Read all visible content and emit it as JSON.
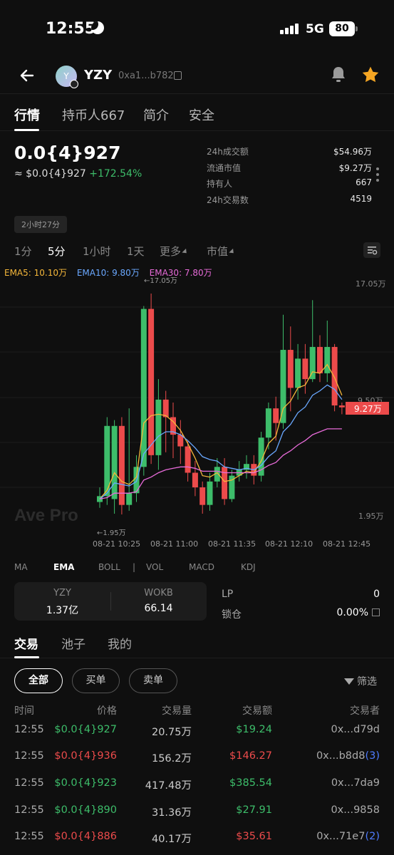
{
  "status_bar": {
    "time": "12:55",
    "network": "5G",
    "battery": "80"
  },
  "header": {
    "token_symbol": "YZY",
    "avatar_letter": "Y",
    "address": "0xa1...b782"
  },
  "tabs": [
    "行情",
    "持币人667",
    "简介",
    "安全"
  ],
  "price": {
    "main": "0.0{4}927",
    "usd_prefix": "≈ $0.0{4}927",
    "change": "+172.54%",
    "age": "2小时27分"
  },
  "stats": [
    {
      "label": "24h成交额",
      "value": "$54.96万"
    },
    {
      "label": "流通市值",
      "value": "$9.27万"
    },
    {
      "label": "持有人",
      "value": "667"
    },
    {
      "label": "24h交易数",
      "value": "4519"
    }
  ],
  "intervals": [
    "1分",
    "5分",
    "1小时",
    "1天",
    "更多",
    "市值"
  ],
  "ema_legend": {
    "ema5": "EMA5: 10.10万",
    "ema10": "EMA10: 9.80万",
    "ema30": "EMA30: 7.80万"
  },
  "chart_labels": {
    "high_marker": "←17.05万",
    "low_marker": "←1.95万",
    "y_top": "17.05万",
    "y_mid": "9.50万",
    "y_bottom": "1.95万",
    "current_tag": "9.27万",
    "watermark": "Ave Pro",
    "x_ticks": [
      "08-21 10:25",
      "08-21 11:00",
      "08-21 11:35",
      "08-21 12:10",
      "08-21 12:45"
    ]
  },
  "chart_data": {
    "type": "candlestick",
    "unit": "万",
    "y_axis_labels": [
      "17.05万",
      "9.50万",
      "1.95万"
    ],
    "x": [
      "08-21 10:25",
      "08-21 11:00",
      "08-21 11:35",
      "08-21 12:10",
      "08-21 12:45"
    ],
    "current": 9.27,
    "high": 17.05,
    "low": 1.95,
    "candles": [
      {
        "o": 2.8,
        "c": 3.2,
        "h": 3.8,
        "l": 2.4
      },
      {
        "o": 3.2,
        "c": 8.0,
        "h": 8.6,
        "l": 2.6
      },
      {
        "o": 3.0,
        "c": 8.0,
        "h": 8.4,
        "l": 2.0
      },
      {
        "o": 8.0,
        "c": 2.6,
        "h": 8.6,
        "l": 1.95
      },
      {
        "o": 2.6,
        "c": 3.4,
        "h": 9.2,
        "l": 2.2
      },
      {
        "o": 3.4,
        "c": 5.2,
        "h": 6.0,
        "l": 2.8
      },
      {
        "o": 5.2,
        "c": 16.0,
        "h": 16.2,
        "l": 4.6
      },
      {
        "o": 16.0,
        "c": 6.0,
        "h": 17.05,
        "l": 5.4
      },
      {
        "o": 6.0,
        "c": 9.8,
        "h": 11.2,
        "l": 5.0
      },
      {
        "o": 9.8,
        "c": 8.6,
        "h": 10.4,
        "l": 6.2
      },
      {
        "o": 8.6,
        "c": 7.4,
        "h": 9.6,
        "l": 5.8
      },
      {
        "o": 7.4,
        "c": 6.6,
        "h": 8.4,
        "l": 5.4
      },
      {
        "o": 6.6,
        "c": 4.8,
        "h": 7.0,
        "l": 4.2
      },
      {
        "o": 4.8,
        "c": 3.8,
        "h": 5.6,
        "l": 3.2
      },
      {
        "o": 3.8,
        "c": 2.6,
        "h": 4.2,
        "l": 2.0
      },
      {
        "o": 2.6,
        "c": 4.2,
        "h": 4.8,
        "l": 2.2
      },
      {
        "o": 4.2,
        "c": 5.2,
        "h": 5.8,
        "l": 3.8
      },
      {
        "o": 5.2,
        "c": 3.0,
        "h": 5.8,
        "l": 2.6
      },
      {
        "o": 3.0,
        "c": 4.6,
        "h": 5.0,
        "l": 2.8
      },
      {
        "o": 4.6,
        "c": 5.0,
        "h": 5.6,
        "l": 4.2
      },
      {
        "o": 5.0,
        "c": 5.4,
        "h": 6.0,
        "l": 4.4
      },
      {
        "o": 5.4,
        "c": 4.6,
        "h": 6.0,
        "l": 4.0
      },
      {
        "o": 4.6,
        "c": 7.2,
        "h": 7.6,
        "l": 4.2
      },
      {
        "o": 7.2,
        "c": 9.2,
        "h": 9.6,
        "l": 6.4
      },
      {
        "o": 9.2,
        "c": 8.2,
        "h": 10.0,
        "l": 7.0
      },
      {
        "o": 8.2,
        "c": 13.2,
        "h": 15.6,
        "l": 7.8
      },
      {
        "o": 13.2,
        "c": 10.6,
        "h": 14.8,
        "l": 9.0
      },
      {
        "o": 10.6,
        "c": 12.6,
        "h": 13.6,
        "l": 9.8
      },
      {
        "o": 12.6,
        "c": 11.2,
        "h": 13.6,
        "l": 10.2
      },
      {
        "o": 11.2,
        "c": 13.4,
        "h": 16.6,
        "l": 11.0
      },
      {
        "o": 13.4,
        "c": 11.6,
        "h": 14.2,
        "l": 11.0
      },
      {
        "o": 11.6,
        "c": 13.4,
        "h": 15.2,
        "l": 11.0
      },
      {
        "o": 13.4,
        "c": 9.4,
        "h": 13.6,
        "l": 9.0
      },
      {
        "o": 9.4,
        "c": 9.27,
        "h": 9.6,
        "l": 8.8
      }
    ],
    "ema5": [
      3.0,
      3.6,
      4.8,
      4.2,
      4.0,
      4.5,
      8.2,
      8.7,
      8.8,
      8.7,
      8.3,
      7.7,
      6.8,
      5.8,
      4.6,
      4.5,
      4.8,
      4.2,
      4.3,
      4.6,
      4.9,
      4.8,
      5.6,
      6.8,
      7.3,
      9.2,
      9.7,
      10.6,
      10.8,
      11.7,
      11.6,
      12.2,
      11.3,
      10.1
    ],
    "ema10": [
      3.0,
      3.4,
      4.1,
      4.0,
      3.9,
      4.2,
      6.1,
      6.7,
      7.3,
      7.6,
      7.6,
      7.4,
      7.0,
      6.5,
      5.9,
      5.7,
      5.6,
      5.2,
      5.1,
      5.0,
      5.1,
      5.0,
      5.3,
      5.9,
      6.3,
      7.6,
      8.1,
      8.9,
      9.3,
      10.1,
      10.4,
      10.8,
      10.5,
      9.8
    ],
    "ema30": [
      3.0,
      3.1,
      3.4,
      3.4,
      3.4,
      3.5,
      4.3,
      4.5,
      4.8,
      5.0,
      5.1,
      5.2,
      5.2,
      5.1,
      4.9,
      4.9,
      4.9,
      4.8,
      4.8,
      4.8,
      4.8,
      4.8,
      5.0,
      5.3,
      5.5,
      6.0,
      6.3,
      6.7,
      7.0,
      7.4,
      7.6,
      7.8,
      7.8,
      7.8
    ]
  },
  "indicators": [
    "MA",
    "EMA",
    "BOLL",
    "|",
    "VOL",
    "MACD",
    "KDJ"
  ],
  "pool": {
    "col1_title": "YZY",
    "col1_value": "1.37亿",
    "col2_title": "WOKB",
    "col2_value": "66.14",
    "lp_label": "LP",
    "lp_value": "0",
    "lock_label": "锁仓",
    "lock_value": "0.00%"
  },
  "trade_tabs": [
    "交易",
    "池子",
    "我的"
  ],
  "filters": [
    "全部",
    "买单",
    "卖单"
  ],
  "filter_btn": "筛选",
  "trade_columns": [
    "时间",
    "价格",
    "交易量",
    "交易额",
    "交易者"
  ],
  "trades": [
    {
      "time": "12:55",
      "price": "$0.0{4}927",
      "qty": "20.75万",
      "amount": "$19.24",
      "trader": "0x...d79d",
      "badge": "",
      "side": "buy"
    },
    {
      "time": "12:55",
      "price": "$0.0{4}936",
      "qty": "156.2万",
      "amount": "$146.27",
      "trader": "0x...b8d8",
      "badge": "(3)",
      "side": "sell"
    },
    {
      "time": "12:55",
      "price": "$0.0{4}923",
      "qty": "417.48万",
      "amount": "$385.54",
      "trader": "0x...7da9",
      "badge": "",
      "side": "buy"
    },
    {
      "time": "12:55",
      "price": "$0.0{4}890",
      "qty": "31.36万",
      "amount": "$27.91",
      "trader": "0x...9858",
      "badge": "",
      "side": "buy"
    },
    {
      "time": "12:55",
      "price": "$0.0{4}886",
      "qty": "40.17万",
      "amount": "$35.61",
      "trader": "0x...71e7",
      "badge": "(2)",
      "side": "sell"
    }
  ]
}
